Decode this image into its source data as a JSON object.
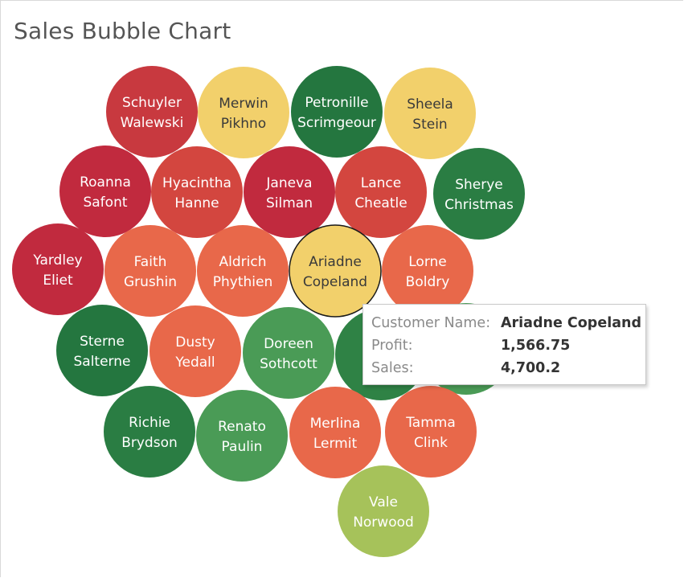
{
  "chart_data": {
    "type": "bubble",
    "title": "Sales Bubble Chart",
    "bubbles": [
      {
        "first": "Schuyler",
        "last": "Walewski",
        "color": "#c8393f"
      },
      {
        "first": "Merwin",
        "last": "Pikhno",
        "color": "#f2d06b"
      },
      {
        "first": "Petronille",
        "last": "Scrimgeour",
        "color": "#24763f"
      },
      {
        "first": "Sheela",
        "last": "Stein",
        "color": "#f2d06b"
      },
      {
        "first": "Roanna",
        "last": "Safont",
        "color": "#c12a3e"
      },
      {
        "first": "Hyacintha",
        "last": "Hanne",
        "color": "#d3463f"
      },
      {
        "first": "Janeva",
        "last": "Silman",
        "color": "#c12a3e"
      },
      {
        "first": "Lance",
        "last": "Cheatle",
        "color": "#d3463f"
      },
      {
        "first": "Sherye",
        "last": "Christmas",
        "color": "#2a7d43"
      },
      {
        "first": "Yardley",
        "last": "Eliet",
        "color": "#c12a3e"
      },
      {
        "first": "Faith",
        "last": "Grushin",
        "color": "#e8684a"
      },
      {
        "first": "Aldrich",
        "last": "Phythien",
        "color": "#e8684a"
      },
      {
        "first": "Ariadne",
        "last": "Copeland",
        "color": "#f2d06b",
        "selected": true
      },
      {
        "first": "Lorne",
        "last": "Boldry",
        "color": "#e8684a"
      },
      {
        "first": "Sterne",
        "last": "Salterne",
        "color": "#24763f"
      },
      {
        "first": "Dusty",
        "last": "Yedall",
        "color": "#e8684a"
      },
      {
        "first": "Doreen",
        "last": "Sothcott",
        "color": "#4a9b56"
      },
      {
        "first": "",
        "last": "",
        "color": "#2f8245"
      },
      {
        "first": "",
        "last": "",
        "color": "#4a9b56"
      },
      {
        "first": "Richie",
        "last": "Brydson",
        "color": "#2a7d43"
      },
      {
        "first": "Renato",
        "last": "Paulin",
        "color": "#4a9b56"
      },
      {
        "first": "Merlina",
        "last": "Lermit",
        "color": "#e8684a"
      },
      {
        "first": "Tamma",
        "last": "Clink",
        "color": "#e8684a"
      },
      {
        "first": "Vale",
        "last": "Norwood",
        "color": "#a6c25a"
      }
    ],
    "tooltip": {
      "label_name": "Customer Name:",
      "value_name": "Ariadne Copeland",
      "label_profit": "Profit:",
      "value_profit": "1,566.75",
      "label_sales": "Sales:",
      "value_sales": "4,700.2"
    }
  }
}
